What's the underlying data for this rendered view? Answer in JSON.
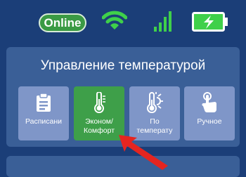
{
  "status": {
    "online_label": "Online",
    "wifi_icon": "wifi-icon",
    "signal_icon": "signal-bars-icon",
    "battery_icon": "battery-charging-icon",
    "accent_green": "#3a9a44"
  },
  "panel": {
    "title": "Управление температурой",
    "tiles": [
      {
        "icon": "clipboard-icon",
        "line1": "Расписани",
        "line2": "",
        "active": false
      },
      {
        "icon": "thermometer-icon",
        "line1": "Эконом/",
        "line2": "Комфорт",
        "active": true
      },
      {
        "icon": "thermometer-sun-icon",
        "line1": "По",
        "line2": "температу",
        "active": false
      },
      {
        "icon": "hand-pointer-icon",
        "line1": "Ручное",
        "line2": "",
        "active": false
      }
    ]
  },
  "annotation": {
    "arrow_icon": "red-arrow-icon",
    "arrow_color": "#e52520"
  }
}
